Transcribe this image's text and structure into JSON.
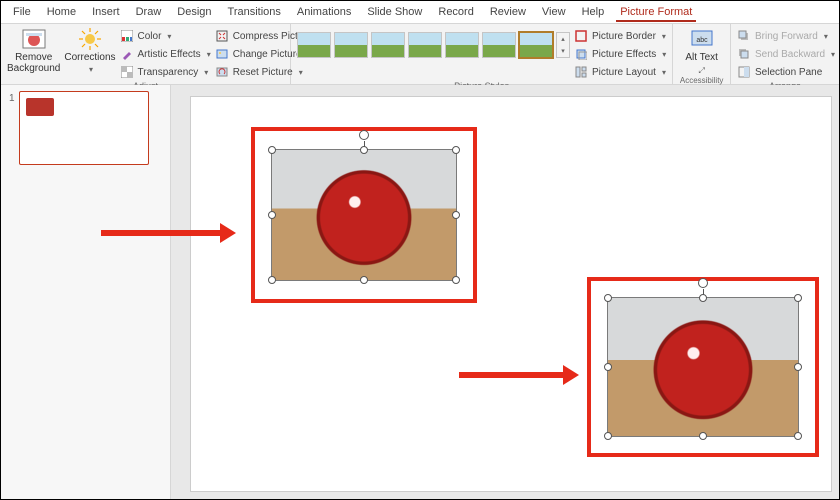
{
  "menu": {
    "tabs": [
      "File",
      "Home",
      "Insert",
      "Draw",
      "Design",
      "Transitions",
      "Animations",
      "Slide Show",
      "Record",
      "Review",
      "View",
      "Help"
    ],
    "context_tab": "Picture Format"
  },
  "ribbon": {
    "remove_bg": "Remove Background",
    "corrections": "Corrections",
    "color": "Color",
    "artistic": "Artistic Effects",
    "transparency": "Transparency",
    "adjust_label": "Adjust",
    "compress": "Compress Pictures",
    "change": "Change Picture",
    "reset": "Reset Picture",
    "styles_label": "Picture Styles",
    "border": "Picture Border",
    "effects": "Picture Effects",
    "layout": "Picture Layout",
    "alt_text": "Alt Text",
    "accessibility_label": "Accessibility",
    "bring_fwd": "Bring Forward",
    "send_back": "Send Backward",
    "sel_pane": "Selection Pane",
    "arrange_label": "Arrange"
  },
  "slides": {
    "current_num": "1"
  },
  "canvas": {
    "image_desc": "red apple on wooden table"
  }
}
